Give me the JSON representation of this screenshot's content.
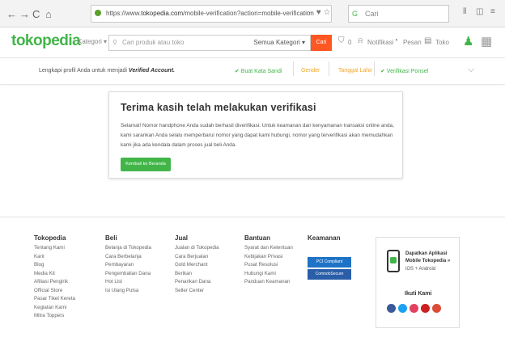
{
  "browser": {
    "back": "←",
    "forward": "→",
    "reload": "C",
    "home": "⌂",
    "url_prefix": "https://www.",
    "url_domain": "tokopedia.com",
    "url_path": "/mobile-verification?action=mobile-verification",
    "url_actions": "⋯ ♥ ☆",
    "search_placeholder": "Cari",
    "icons": [
      "library-icon",
      "sidebar-icon",
      "menu-icon"
    ]
  },
  "header": {
    "logo": "tokopedia",
    "kategori": "Kategori ▾",
    "search_placeholder": "Cari produk atau toko",
    "search_category": "Semua Kategori ▾",
    "search_button": "Cari",
    "cart": "0",
    "notif": "Notifikasi",
    "pesan": "Pesan",
    "toko": "Toko"
  },
  "profile_bar": {
    "message": "Lengkapi profil Anda untuk menjadi ",
    "message_bold": "Verified Account.",
    "steps": [
      "✔ Buat Kata Sandi",
      "Gender",
      "Tanggal Lahir",
      "✔ Verifikasi Ponsel"
    ],
    "collapse": "⌵"
  },
  "card": {
    "title": "Terima kasih telah melakukan verifikasi",
    "body": "Selamat! Nomor handphone Anda sudah berhasil diverifikasi. Untuk keamanan dan kenyamanan transaksi online anda, kami sarankan Anda selalu memperbarui nomor yang dapat kami hubungi, nomor yang terverifikasi akan memudahkan kami jika ada kendala dalam proses jual beli Anda.",
    "button": "Kembali ke Beranda"
  },
  "footer": {
    "columns": [
      {
        "title": "Tokopedia",
        "items": [
          "Tentang Kami",
          "Karir",
          "Blog",
          "Media Kit",
          "Afiliasi Pengirik",
          "Official Store",
          "Pasar Tiket Kereta",
          "Kegiatan Kami",
          "Mitra Toppers"
        ]
      },
      {
        "title": "Beli",
        "items": [
          "Belanja di Tokopedia",
          "Cara Berbelanja",
          "Pembayaran",
          "Pengembalian Dana",
          "Hot List",
          "Isi Ulang Pulsa"
        ]
      },
      {
        "title": "Jual",
        "items": [
          "Jualan di Tokopedia",
          "Cara Berjualan",
          "Gold Merchant",
          "Berikan",
          "Penarikan Dana",
          "Seller Center"
        ]
      },
      {
        "title": "Bantuan",
        "items": [
          "Syarat dan Ketentuan",
          "Kebijakan Privasi",
          "Pusat Resolusi",
          "Hubungi Kami",
          "Panduan Keamanan"
        ]
      },
      {
        "title": "Keamanan",
        "items": []
      }
    ],
    "badges": [
      "PCI Compliant",
      "ComodoSecure"
    ],
    "app": {
      "title_line1": "Dapatkan Aplikasi",
      "title_line2": "Mobile Tokopedia »",
      "platforms": "iOS + Android",
      "ikuti": "Ikuti Kami"
    },
    "social_colors": [
      "#3b5998",
      "#1da1f2",
      "#e4405f",
      "#cd201f",
      "#dd4b39"
    ],
    "accent": "#42b549"
  }
}
